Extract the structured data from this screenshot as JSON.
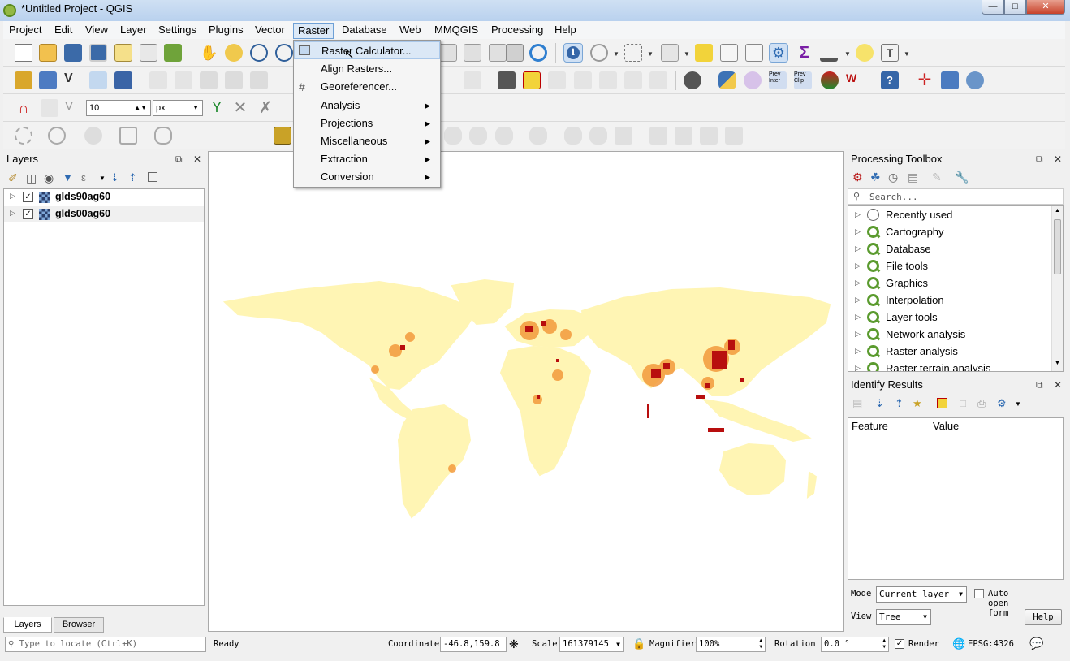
{
  "window": {
    "title": "*Untitled Project - QGIS"
  },
  "menubar": {
    "items": [
      "Project",
      "Edit",
      "View",
      "Layer",
      "Settings",
      "Plugins",
      "Vector",
      "Raster",
      "Database",
      "Web",
      "MMQGIS",
      "Processing",
      "Help"
    ],
    "active": "Raster"
  },
  "raster_menu": {
    "items": [
      "Raster Calculator...",
      "Align Rasters...",
      "Georeferencer...",
      "Analysis",
      "Projections",
      "Miscellaneous",
      "Extraction",
      "Conversion"
    ],
    "highlighted": "Raster Calculator..."
  },
  "digitizing": {
    "width_value": "10",
    "unit": "px"
  },
  "layers_panel": {
    "title": "Layers",
    "layers": [
      {
        "name": "glds90ag60",
        "checked": true
      },
      {
        "name": "glds00ag60",
        "checked": true
      }
    ],
    "tabs": [
      "Layers",
      "Browser"
    ]
  },
  "processing_toolbox": {
    "title": "Processing Toolbox",
    "search_placeholder": "Search...",
    "items": [
      "Recently used",
      "Cartography",
      "Database",
      "File tools",
      "Graphics",
      "Interpolation",
      "Layer tools",
      "Network analysis",
      "Raster analysis",
      "Raster terrain analysis"
    ]
  },
  "identify_results": {
    "title": "Identify Results",
    "columns": [
      "Feature",
      "Value"
    ],
    "mode_label": "Mode",
    "mode_value": "Current layer",
    "auto_open_label": "Auto open form",
    "view_label": "View",
    "view_value": "Tree",
    "help_label": "Help"
  },
  "statusbar": {
    "locate_placeholder": "Type to locate (Ctrl+K)",
    "status": "Ready",
    "coordinate_label": "Coordinate",
    "coordinate_value": "-46.8,159.8",
    "scale_label": "Scale",
    "scale_value": "161379145",
    "magnifier_label": "Magnifier",
    "magnifier_value": "100%",
    "rotation_label": "Rotation",
    "rotation_value": "0.0 °",
    "render_label": "Render",
    "crs": "EPSG:4326"
  },
  "colors": {
    "map_low": "#fff3b0",
    "map_mid": "#f39a3c",
    "map_high": "#b80e0e",
    "selection": "#dbe8f6"
  }
}
